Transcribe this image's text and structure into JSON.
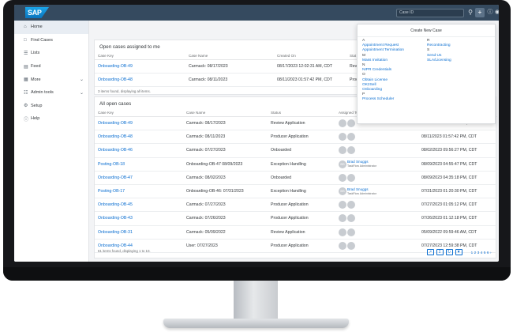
{
  "shell": {
    "logo": "SAP",
    "search_placeholder": "Case ID"
  },
  "sidebar": {
    "items": [
      {
        "label": "Home"
      },
      {
        "label": "Find Cases"
      },
      {
        "label": "Lists"
      },
      {
        "label": "Feed"
      },
      {
        "label": "More"
      },
      {
        "label": "Admin tools"
      },
      {
        "label": "Setup"
      },
      {
        "label": "Help"
      }
    ]
  },
  "open_assigned": {
    "title": "Open cases assigned to me",
    "columns": [
      "Case Key",
      "Case Name",
      "Created On",
      "Stat"
    ],
    "rows": [
      {
        "key": "Onboarding-OB-49",
        "name": "Carmack: 08/17/2023",
        "created": "08/17/2023 12:02:31 AM, CDT",
        "status": "Revie"
      },
      {
        "key": "Onboarding-OB-48",
        "name": "Carmack: 08/11/2023",
        "created": "08/11/2023 01:57:42 PM, CDT",
        "status": "Prod"
      }
    ],
    "footnote": "3 items found, displaying all items."
  },
  "all_open": {
    "title": "All open cases",
    "columns": [
      "Case Key",
      "Case Name",
      "Status",
      "Assigned To",
      ""
    ],
    "rows": [
      {
        "key": "Onboarding-OB-49",
        "name": "Carmack: 08/17/2023",
        "status": "Review Application",
        "assignee": "",
        "assignee_sub": "",
        "date": "08/17/2023 12:02:31 AM, CDT"
      },
      {
        "key": "Onboarding-OB-48",
        "name": "Carmack: 08/11/2023",
        "status": "Producer Application",
        "assignee": "",
        "assignee_sub": "",
        "date": "08/11/2023 01:57:42 PM, CDT"
      },
      {
        "key": "Onboarding-OB-46",
        "name": "Carmack: 07/27/2023",
        "status": "Onboarded",
        "assignee": "",
        "assignee_sub": "",
        "date": "08/02/2023 09:56:27 PM, CDT"
      },
      {
        "key": "Posting-OB-18",
        "name": "Onboarding-OB-47 08/09/2023",
        "status": "Exception Handling",
        "assignee": "Brad Snuggs",
        "assignee_sub": "TaskFlow Administrator",
        "date": "08/09/2023 04:55:47 PM, CDT"
      },
      {
        "key": "Onboarding-OB-47",
        "name": "Carmack: 08/02/2023",
        "status": "Onboarded",
        "assignee": "",
        "assignee_sub": "",
        "date": "08/09/2023 04:35:18 PM, CDT"
      },
      {
        "key": "Posting-OB-17",
        "name": "Onboarding-OB-46: 07/31/2023",
        "status": "Exception Handling",
        "assignee": "Brad Snuggs",
        "assignee_sub": "TaskFlow Administrator",
        "date": "07/31/2023 01:20:30 PM, CDT"
      },
      {
        "key": "Onboarding-OB-45",
        "name": "Carmack: 07/27/2023",
        "status": "Producer Application",
        "assignee": "",
        "assignee_sub": "",
        "date": "07/27/2023 01:05:12 PM, CDT"
      },
      {
        "key": "Onboarding-OB-43",
        "name": "Carmack: 07/26/2023",
        "status": "Producer Application",
        "assignee": "",
        "assignee_sub": "",
        "date": "07/26/2023 01:12:18 PM, CDT"
      },
      {
        "key": "Onboarding-OB-31",
        "name": "Carmack: 05/09/2022",
        "status": "Review Application",
        "assignee": "",
        "assignee_sub": "",
        "date": "05/09/2022 09:59:46 AM, CDT"
      },
      {
        "key": "Onboarding-OB-44",
        "name": "User: 07/27/2023",
        "status": "Producer Application",
        "assignee": "",
        "assignee_sub": "",
        "date": "07/27/2023 12:59:38 PM, CDT"
      }
    ],
    "footnote": "61 items found, displaying 1 to 10.",
    "pages": [
      "1",
      "2",
      "3",
      "4",
      "5",
      "6"
    ]
  },
  "create_case": {
    "title": "Create New Case",
    "left": [
      {
        "letter": "A",
        "links": [
          "Appointment Request",
          "Appointment Termination"
        ]
      },
      {
        "letter": "M",
        "links": [
          "Mass Invitation"
        ]
      },
      {
        "letter": "N",
        "links": [
          "NIPR Credentials"
        ]
      },
      {
        "letter": "O",
        "links": [
          "Obtain License",
          "OK2Sell",
          "Onboarding"
        ]
      },
      {
        "letter": "P",
        "links": [
          "Process Scheduler"
        ]
      }
    ],
    "right": [
      {
        "letter": "R",
        "links": [
          "Recontracting"
        ]
      },
      {
        "letter": "S",
        "links": [
          "Send Us",
          "SLA/Licensing"
        ]
      }
    ]
  }
}
